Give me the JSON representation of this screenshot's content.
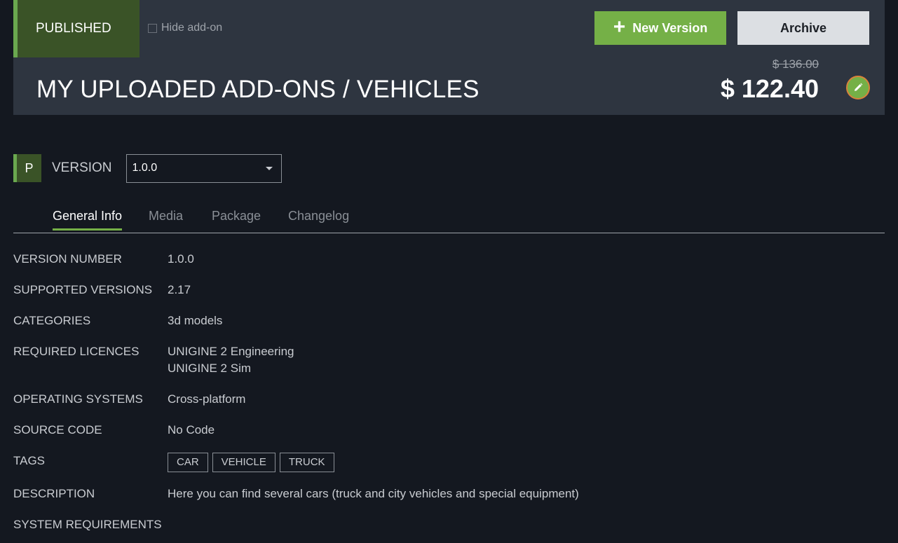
{
  "header": {
    "status": "PUBLISHED",
    "hide_label": "Hide add-on",
    "new_version_label": "New Version",
    "archive_label": "Archive",
    "title": "MY UPLOADED ADD-ONS / VEHICLES",
    "price_old": "$ 136.00",
    "price_new": "$ 122.40"
  },
  "version": {
    "badge": "P",
    "label": "VERSION",
    "selected": "1.0.0"
  },
  "tabs": [
    {
      "label": "General Info",
      "active": true
    },
    {
      "label": "Media"
    },
    {
      "label": "Package"
    },
    {
      "label": "Changelog"
    }
  ],
  "info": {
    "version_number": {
      "label": "VERSION NUMBER",
      "value": "1.0.0"
    },
    "supported_versions": {
      "label": "SUPPORTED VERSIONS",
      "value": "2.17"
    },
    "categories": {
      "label": "CATEGORIES",
      "value": "3d models"
    },
    "required_licences": {
      "label": "REQUIRED LICENCES",
      "values": [
        "UNIGINE 2 Engineering",
        "UNIGINE 2 Sim"
      ]
    },
    "operating_systems": {
      "label": "OPERATING SYSTEMS",
      "value": "Cross-platform"
    },
    "source_code": {
      "label": "SOURCE CODE",
      "value": "No Code"
    },
    "tags": {
      "label": "TAGS",
      "values": [
        "CAR",
        "VEHICLE",
        "TRUCK"
      ]
    },
    "description": {
      "label": "DESCRIPTION",
      "value": "Here you can find several cars (truck and city vehicles and special equipment)"
    },
    "system_requirements": {
      "label": "SYSTEM REQUIREMENTS"
    }
  },
  "colors": {
    "accent": "#75b047",
    "badge_bg": "#3a5327",
    "header_bg": "#2e3540",
    "page_bg": "#141820"
  }
}
